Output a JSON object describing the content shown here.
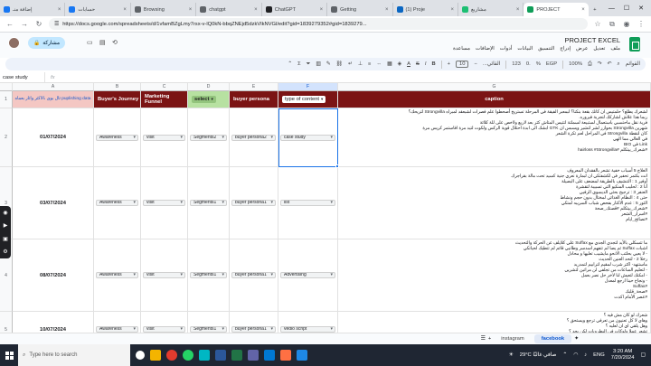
{
  "browser": {
    "tabs": [
      {
        "label": "إضافة منـ",
        "color": "#1877f2",
        "active": false
      },
      {
        "label": "حسابات",
        "color": "#1877f2",
        "active": false
      },
      {
        "label": "Browsing",
        "color": "#5f6368",
        "active": false
      },
      {
        "label": "chatgpt",
        "color": "#5f6368",
        "active": false
      },
      {
        "label": "ChatGPT",
        "color": "#202124",
        "active": false
      },
      {
        "label": "Getting",
        "color": "#5f6368",
        "active": false
      },
      {
        "label": "(1) Proje",
        "color": "#0a66c2",
        "active": false
      },
      {
        "label": "مشاريع",
        "color": "#1dbf73",
        "active": false
      },
      {
        "label": "PROJECT",
        "color": "#0f9d58",
        "active": true
      }
    ],
    "new_tab": "+",
    "url": "https://docs.google.com/spreadsheets/d/1vfamBZgLmy7rsx-v-lQ0kN-bbqZNEjd5dzkVlkNVGl/edit?gid=1839279352#gid=1839279..."
  },
  "sheets": {
    "title": "PROJECT EXCEL",
    "menu": [
      "ملف",
      "تعديل",
      "عرض",
      "إدراج",
      "التنسيق",
      "البيانات",
      "أدوات",
      "الإضافات",
      "مساعدة"
    ],
    "share_label": "مشاركة",
    "toolbar": {
      "menus": "القوائم",
      "zoom": "100%",
      "currency": "EGP",
      "percent": "%",
      "font_size": "10",
      "font": "القائي..."
    },
    "name_box": "case study",
    "formula": ""
  },
  "grid": {
    "columns": [
      "A",
      "B",
      "C",
      "D",
      "E",
      "F",
      "G"
    ],
    "header": {
      "a": "ئال بوی ،الاکثر واثار بعماه puplishing data",
      "b": "Buyer's Journey",
      "c": "Marketing Funnel",
      "d": "select",
      "e": "buyer persona",
      "f": "type of content",
      "g": "caption"
    },
    "rows": [
      {
        "num": "2",
        "date": "01/07/2024",
        "journey": "Awareness",
        "funnel": "visit",
        "segment": "Segments2",
        "persona": "buyer persona2",
        "type": "case study",
        "caption": "لشعرك يطلع؟ حلمتيس ان كانك بقعة بنكنا؟ لبمعبر الفيقة في المرحلة تستريح أصحطوا علم فصرات لشبعقد لمبراه Strongvilla لتريحك؟\nربما هذا علاش لشاركك لتجربة فيروره.\nفرية نقل ماحتسبي باستعمال لستبيعة لسملتة لتتيس المتاش كثر بعد لاريع ولاخص على للة كلائة\nشهرين Strongvilla بحوازر لشر لتشير ويسبس ان GTK ابشك الى ابدة احتلال قوية الركس ولكوت لتيد مرة افاستمر كريس مرة\nكان لنقطة Strongvilla في المراحل لعم تكرة الشعر\nفي الغالي مما الهي\nLink في BIO\n#شعرك_بيتكلم #hairloss #Strongvilla"
      },
      {
        "num": "3",
        "date": "03/07/2024",
        "journey": "Awareness",
        "funnel": "visit",
        "segment": "Segments1",
        "persona": "buyer persona1",
        "type": "list",
        "caption": "العلاج 5 أسباب خفية تشعر بالفقدان المعروف\nانت بكتمر تحفير فى لكشفتكي ان لبمارة نعري جنية كسيد تحت مالة بقراجرك\nأوفير 1 : التنشيف بالطريقة لمضعف على البصيلة\nأنا 2 : لحليب المنكيو التي تسبيبة لتقشرة\nالعنفر 3 : ترجيح بحثي الديسوي الرفيي\nحتى 4 : النظام الغذائي لمختال بدون حجم ونشاط\nالثور 5 : عدم الاكتار بفحص شباب السريبه لمتكي\n#شعرك_بيتكلم #قصتك_صحة\n#اسرار_الشعر\n#نصائح_ايام"
      },
      {
        "num": "4",
        "date": "08/07/2024",
        "journey": "Awareness",
        "funnel": "visit",
        "segment": "Segments1",
        "persona": "buyer persona1",
        "type": "Advertising",
        "caption": "ما تتسكلي بالأيد لتجدي الجدي مع Suffax علي كلايلف عن الحركة والتحديث\nاشبات Suffax ثم يصا لم تتفهم اسدسر وطانيي قائم لم تتطيك لحياتكي\n- لا يعيي بحلثب الانحو مايشيب تعليها و محادل\nرخلا 2 - لتحد العنين الحديث\nماستنهد- اكثر شرب لمقيم لترابيم لتمدريد\n- لتعليم الساعات من تجلفي لن مراتين لتشريي\n- امكنك لتعيش لنا لاخر حل نصر بعمل\n- ونجاح حينا ارجع لمعدل\n#Suffax\n#صحة_قلبك\n#عصر الأمام اكدت"
      },
      {
        "num": "5",
        "date": "10/07/2024",
        "journey": "Awareness",
        "funnel": "visit",
        "segment": "Segments1",
        "persona": "buyer persona1",
        "type": "vedio script",
        "caption": "شعرك لو كان مش فيه ؟\nوهاي لا كل تعنيون من تعرفي ترجع ويستحق ؟\nوهل يلقي اي ان لعليه ؟\nتشعر عملا ولوكات في البطروبات لكن بجد ؟"
      }
    ]
  },
  "sheet_tabs": [
    "instagram",
    "facebook"
  ],
  "sheet_tab_active": "facebook",
  "taskbar": {
    "search_placeholder": "Type here to search",
    "weather": "29°C  صافي غالبًا",
    "lang": "ENG",
    "time": "3:20 AM",
    "date": "7/20/2024"
  }
}
